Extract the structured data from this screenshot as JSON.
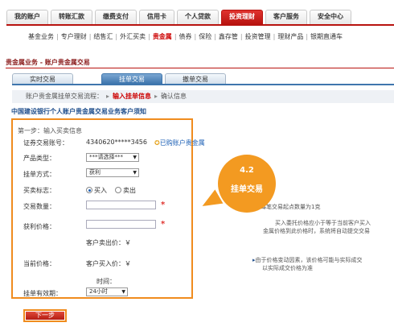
{
  "topnav": {
    "tabs": [
      {
        "label": "我的账户"
      },
      {
        "label": "转账汇款"
      },
      {
        "label": "缴费支付"
      },
      {
        "label": "信用卡"
      },
      {
        "label": "个人贷款"
      },
      {
        "label": "投资理财",
        "active": true
      },
      {
        "label": "客户服务"
      },
      {
        "label": "安全中心"
      }
    ],
    "accent_color": "#b8130f"
  },
  "subnav": {
    "items": [
      "基金业务",
      "专户理财",
      "结售汇",
      "外汇买卖",
      "贵金属",
      "债券",
      "保险",
      "鑫存管",
      "投资管理",
      "理财产品",
      "银期直通车"
    ],
    "active_index": 4
  },
  "page": {
    "title": "贵金属业务 - 账户贵金属交易"
  },
  "tabs": {
    "items": [
      "实时交易",
      "挂单交易",
      "撤单交易"
    ],
    "active_index": 1
  },
  "steps": {
    "items": [
      "账户贵金属挂单交易流程：",
      "输入挂单信息",
      "确认信息"
    ],
    "active_index": 1
  },
  "notice": {
    "title": "中国建设银行个人账户贵金属交易业务客户须知"
  },
  "form": {
    "step_label": "第一步：输入买卖信息",
    "securities_account_label": "证券交易账号：",
    "securities_account_value": "4340620*****3456",
    "purchased_link": "已购账户贵金属",
    "product_type_label": "产品类型：",
    "product_type_value": "***请选择***",
    "order_mode_label": "挂单方式：",
    "order_mode_value": "获利",
    "trade_flag_label": "买卖标志：",
    "buy_label": "买入",
    "sell_label": "卖出",
    "quantity_label": "交易数量：",
    "profit_price_label": "获利价格：",
    "current_price_label": "当前价格：",
    "sell_price_label": "客户卖出价：￥",
    "buy_price_label": "客户买入价：￥",
    "time_label": "时间：",
    "validity_label": "挂单有效期：",
    "validity_value": "24小时",
    "required_mark": "*",
    "next_button": "下一步"
  },
  "right_notes": {
    "min_qty": "每笔交易起点数量为1克",
    "buy_order_line1": "买入委托价格应小于等于当前客户买入",
    "buy_order_line2": "金属价格到此价格时，系统将自动提交交易",
    "price_note_line1": "由于价格变动因素，该价格可能与实际成交",
    "price_note_line2": "以实际成交价格为准"
  },
  "callout": {
    "number": "4.2",
    "title": "挂单交易",
    "color": "#f39a21"
  }
}
